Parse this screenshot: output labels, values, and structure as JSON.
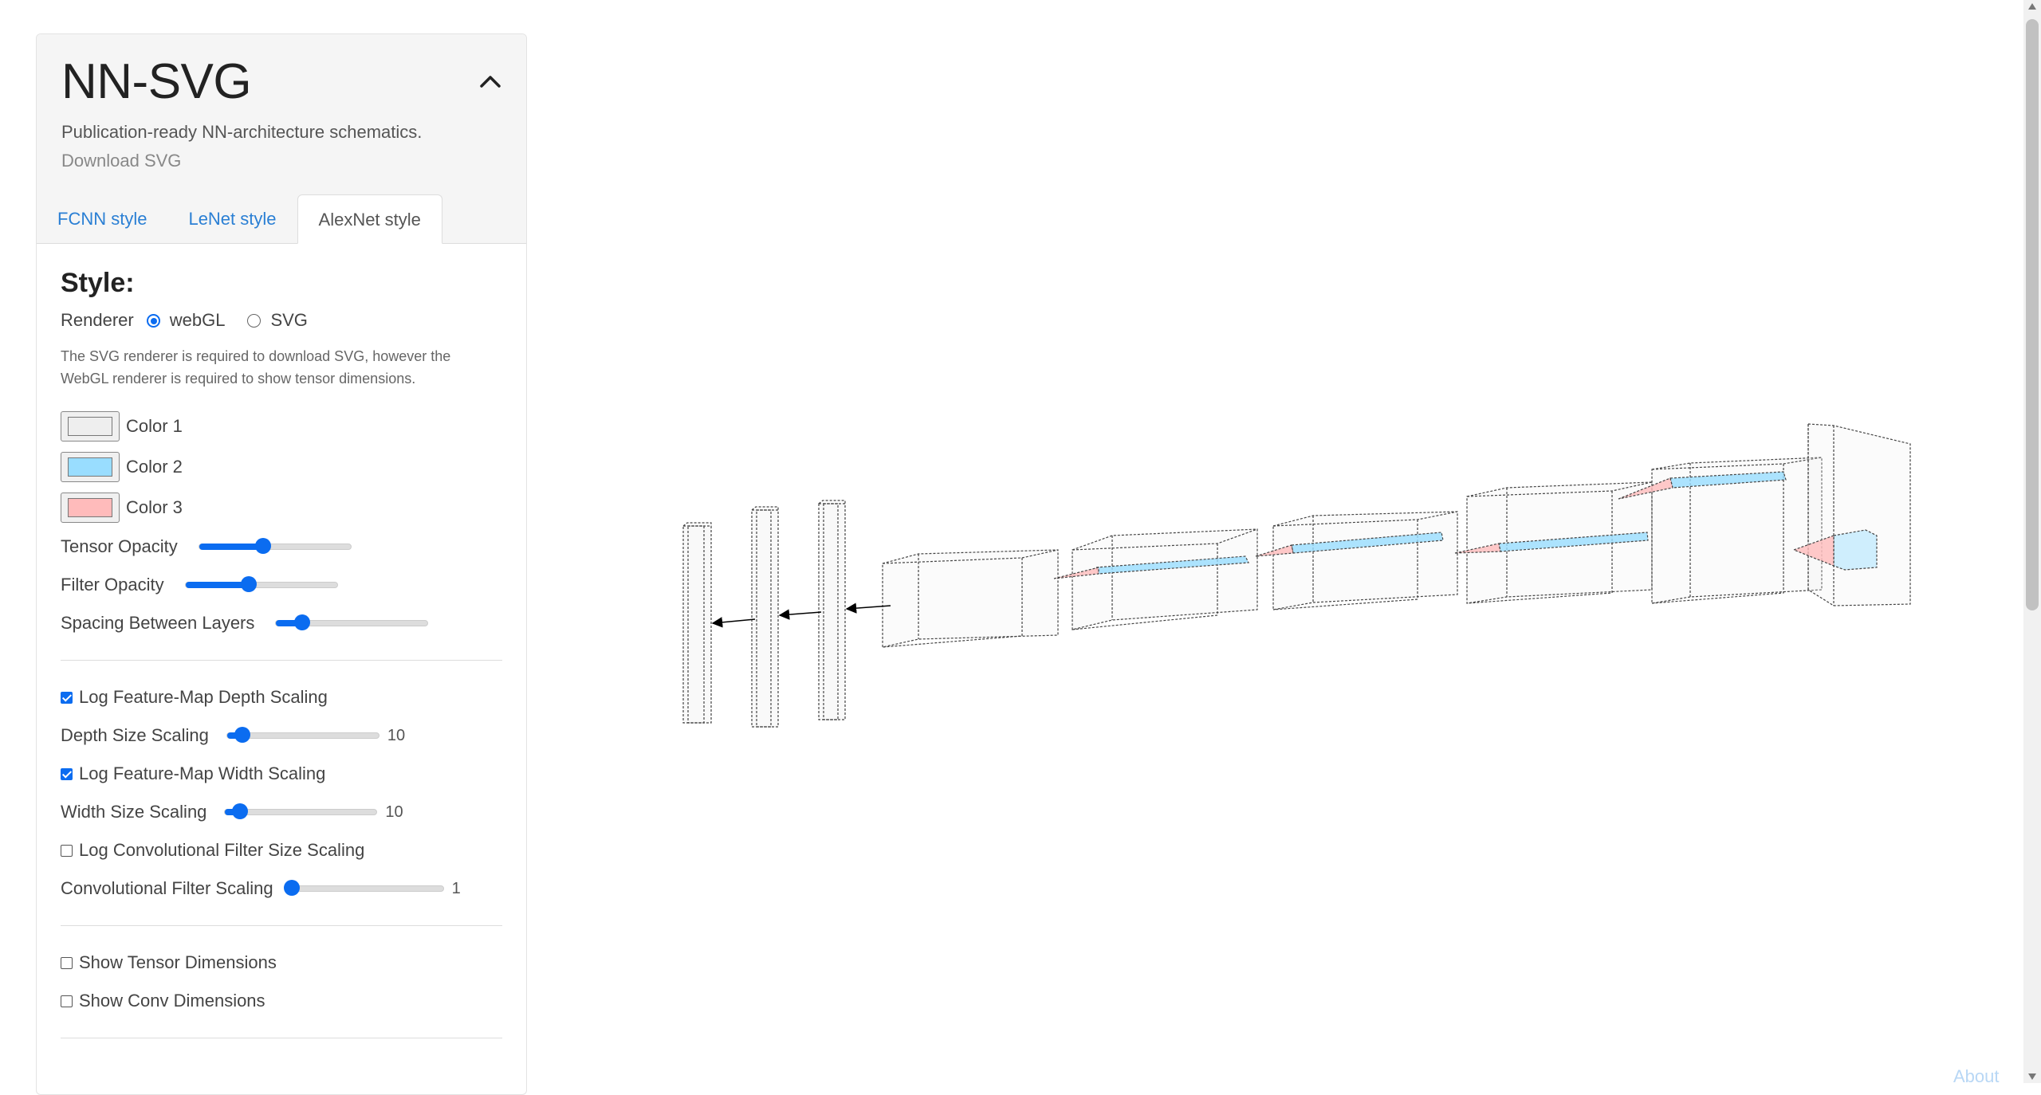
{
  "app": {
    "title": "NN-SVG",
    "subtitle": "Publication-ready NN-architecture schematics.",
    "download_label": "Download SVG"
  },
  "tabs": [
    {
      "label": "FCNN style"
    },
    {
      "label": "LeNet style"
    },
    {
      "label": "AlexNet style",
      "active": true
    }
  ],
  "style": {
    "heading": "Style:",
    "renderer_label": "Renderer",
    "renderer_options": [
      {
        "label": "webGL",
        "selected": true
      },
      {
        "label": "SVG",
        "selected": false
      }
    ],
    "note": "The SVG renderer is required to download SVG, however the WebGL renderer is required to show tensor dimensions."
  },
  "colors": [
    {
      "label": "Color 1",
      "value": "#eeeeee"
    },
    {
      "label": "Color 2",
      "value": "#99ddff"
    },
    {
      "label": "Color 3",
      "value": "#ffbbbb"
    }
  ],
  "sliders": [
    {
      "label": "Tensor Opacity",
      "fraction": 0.42
    },
    {
      "label": "Filter Opacity",
      "fraction": 0.42
    },
    {
      "label": "Spacing Between Layers",
      "fraction": 0.17
    }
  ],
  "scaling": {
    "log_depth": {
      "label": "Log Feature-Map Depth Scaling",
      "checked": true
    },
    "depth_size": {
      "label": "Depth Size Scaling",
      "value": "10",
      "fraction": 0.1
    },
    "log_width": {
      "label": "Log Feature-Map Width Scaling",
      "checked": true
    },
    "width_size": {
      "label": "Width Size Scaling",
      "value": "10",
      "fraction": 0.1
    },
    "log_conv": {
      "label": "Log Convolutional Filter Size Scaling",
      "checked": false
    },
    "conv_scaling": {
      "label": "Convolutional Filter Scaling",
      "value": "1",
      "fraction": 0.0
    }
  },
  "display": {
    "show_tensor_dims": {
      "label": "Show Tensor Dimensions",
      "checked": false
    },
    "show_conv_dims": {
      "label": "Show Conv Dimensions",
      "checked": false
    }
  },
  "footer": {
    "about_label": "About"
  },
  "palette": {
    "accent": "#0b6cf0",
    "link": "#2a7fd4",
    "tensor": "#eeeeee",
    "filter_blue": "#99ddff",
    "filter_red": "#ffbbbb"
  }
}
